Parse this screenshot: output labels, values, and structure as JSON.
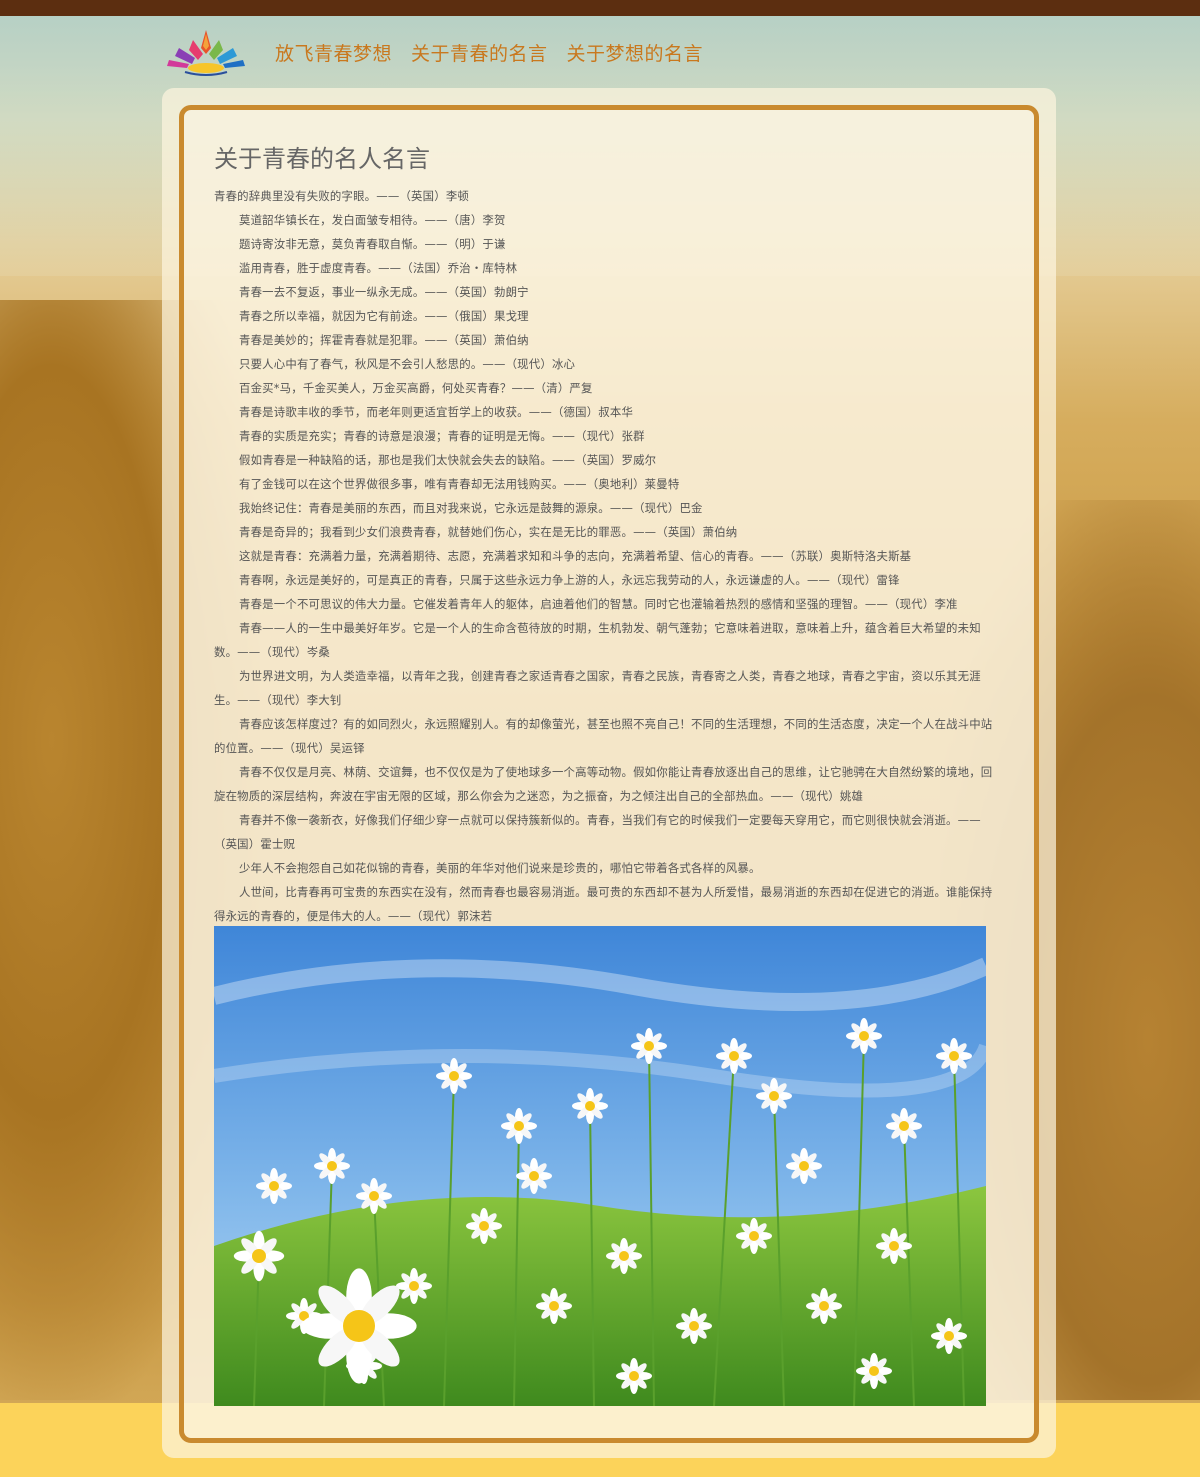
{
  "nav": {
    "items": [
      {
        "label": "放飞青春梦想"
      },
      {
        "label": "关于青春的名言"
      },
      {
        "label": "关于梦想的名言"
      }
    ]
  },
  "article": {
    "title": "关于青春的名人名言",
    "quotes": [
      "青春的辞典里没有失败的字眼。——（英国）李顿",
      "莫道韶华镇长在，发白面皱专相待。——（唐）李贺",
      "题诗寄汝非无意，莫负青春取自惭。——（明）于谦",
      "滥用青春，胜于虚度青春。——（法国）乔治・库特林",
      "青春一去不复返，事业一纵永无成。——（英国）勃朗宁",
      "青春之所以幸福，就因为它有前途。——（俄国）果戈理",
      "青春是美妙的；挥霍青春就是犯罪。——（英国）萧伯纳",
      "只要人心中有了春气，秋风是不会引人愁思的。——（现代）冰心",
      "百金买*马，千金买美人，万金买高爵，何处买青春？——（清）严复",
      "青春是诗歌丰收的季节，而老年则更适宜哲学上的收获。——（德国）叔本华",
      "青春的实质是充实；青春的诗意是浪漫；青春的证明是无悔。——（现代）张群",
      "假如青春是一种缺陷的话，那也是我们太快就会失去的缺陷。——（英国）罗威尔",
      "有了金钱可以在这个世界做很多事，唯有青春却无法用钱购买。——（奥地利）莱曼特",
      "我始终记住：青春是美丽的东西，而且对我来说，它永远是鼓舞的源泉。——（现代）巴金",
      "青春是奇异的；我看到少女们浪费青春，就替她们伤心，实在是无比的罪恶。——（英国）萧伯纳",
      "这就是青春：充满着力量，充满着期待、志愿，充满着求知和斗争的志向，充满着希望、信心的青春。——（苏联）奥斯特洛夫斯基",
      "青春啊，永远是美好的，可是真正的青春，只属于这些永远力争上游的人，永远忘我劳动的人，永远谦虚的人。——（现代）雷锋",
      "青春是一个不可思议的伟大力量。它催发着青年人的躯体，启迪着他们的智慧。同时它也灌输着热烈的感情和坚强的理智。——（现代）李准",
      "青春——人的一生中最美好年岁。它是一个人的生命含苞待放的时期，生机勃发、朝气蓬勃；它意味着进取，意味着上升，蕴含着巨大希望的未知数。——（现代）岑桑",
      "为世界进文明，为人类造幸福，以青年之我，创建青春之家适青春之国家，青春之民族，青春寄之人类，青春之地球，青春之宇宙，资以乐其无涯生。——（现代）李大钊",
      "青春应该怎样度过？有的如同烈火，永远照耀别人。有的却像萤光，甚至也照不亮自己！不同的生活理想，不同的生活态度，决定一个人在战斗中站的位置。——（现代）吴运铎",
      "青春不仅仅是月亮、林荫、交谊舞，也不仅仅是为了使地球多一个高等动物。假如你能让青春放逐出自己的思维，让它驰骋在大自然纷繁的境地，回旋在物质的深层结构，奔波在宇宙无限的区域，那么你会为之迷恋，为之振奋，为之倾注出自己的全部热血。——（现代）姚雄",
      "青春并不像一袭新衣，好像我们仔细少穿一点就可以保持簇新似的。青春，当我们有它的时候我们一定要每天穿用它，而它则很快就会消逝。——（英国）霍士贶",
      "少年人不会抱怨自己如花似锦的青春，美丽的年华对他们说来是珍贵的，哪怕它带着各式各样的风暴。",
      "人世间，比青春再可宝贵的东西实在没有，然而青春也最容易消逝。最可贵的东西却不甚为人所爱惜，最易消逝的东西却在促进它的消逝。谁能保持得永远的青春的，便是伟大的人。——（现代）郭沫若"
    ]
  },
  "colors": {
    "topbar": "#5c2e10",
    "nav_text": "#c9781e",
    "frame_border": "#c98a2e",
    "footer_band": "#fcd35a"
  },
  "icons": {
    "logo": "lotus-logo-icon",
    "photo": "daisy-field-image"
  }
}
